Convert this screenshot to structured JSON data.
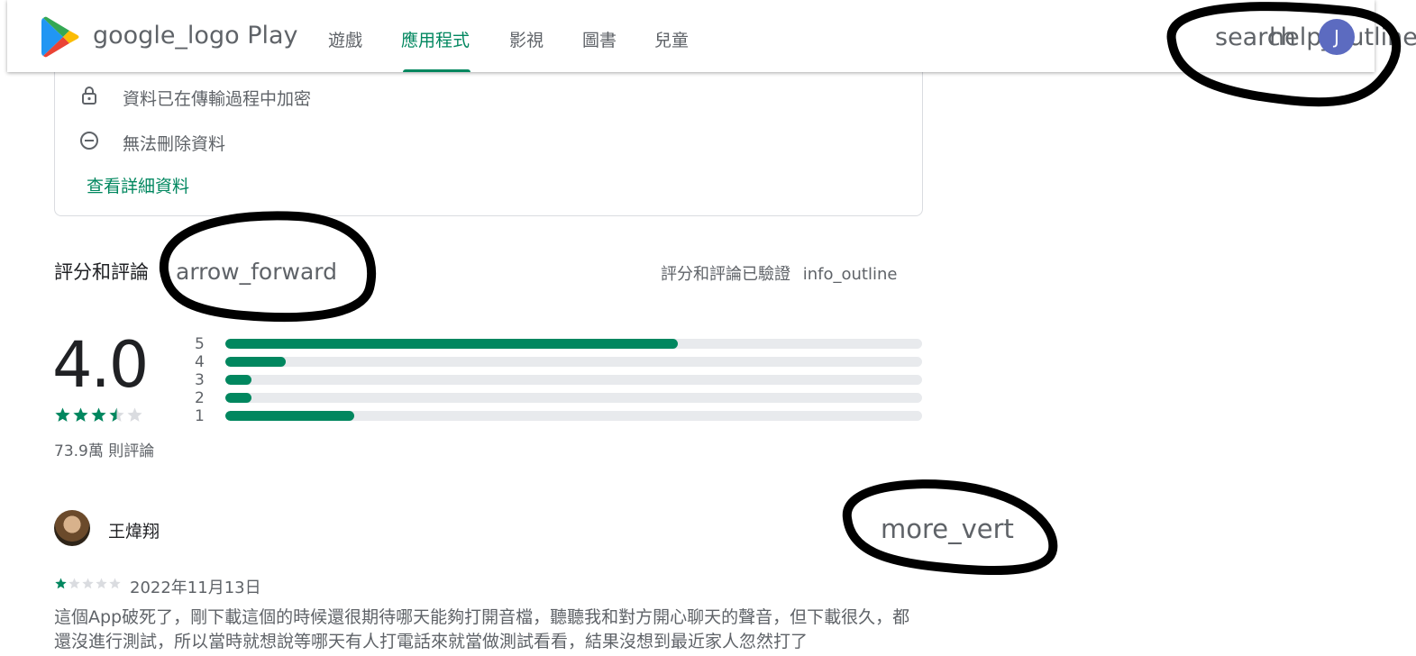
{
  "header": {
    "brand": "google_logo Play",
    "tabs": [
      {
        "label": "遊戲",
        "active": false
      },
      {
        "label": "應用程式",
        "active": true
      },
      {
        "label": "影視",
        "active": false
      },
      {
        "label": "圖書",
        "active": false
      },
      {
        "label": "兒童",
        "active": false
      }
    ],
    "search_icon_text": "search",
    "help_icon_text": "help_outline",
    "avatar_initial": "J"
  },
  "data_safety": {
    "encrypted": "資料已在傳輸過程中加密",
    "no_delete": "無法刪除資料",
    "details_link": "查看詳細資料"
  },
  "ratings": {
    "title": "評分和評論",
    "arrow_icon_text": "arrow_forward",
    "verified_text": "評分和評論已驗證",
    "info_icon_text": "info_outline",
    "score": "4.0",
    "stars": 3.5,
    "review_count": "73.9萬 則評論",
    "distribution": [
      {
        "stars": "5",
        "fraction": 0.65
      },
      {
        "stars": "4",
        "fraction": 0.087
      },
      {
        "stars": "3",
        "fraction": 0.037
      },
      {
        "stars": "2",
        "fraction": 0.038
      },
      {
        "stars": "1",
        "fraction": 0.185
      }
    ]
  },
  "review": {
    "author": "王煒翔",
    "more_icon_text": "more_vert",
    "stars": 1,
    "date": "2022年11月13日",
    "text": "這個App破死了，剛下載這個的時候還很期待哪天能夠打開音檔，聽聽我和對方開心聊天的聲音，但下載很久，都還沒進行測試，所以當時就想說等哪天有人打電話來就當做測試看看，結果沒想到最近家人忽然打了"
  },
  "colors": {
    "accent": "#01875f",
    "track": "#e8eaed",
    "text_secondary": "#5f6368",
    "avatar": "#5c6bc0",
    "marker": "#000000"
  }
}
